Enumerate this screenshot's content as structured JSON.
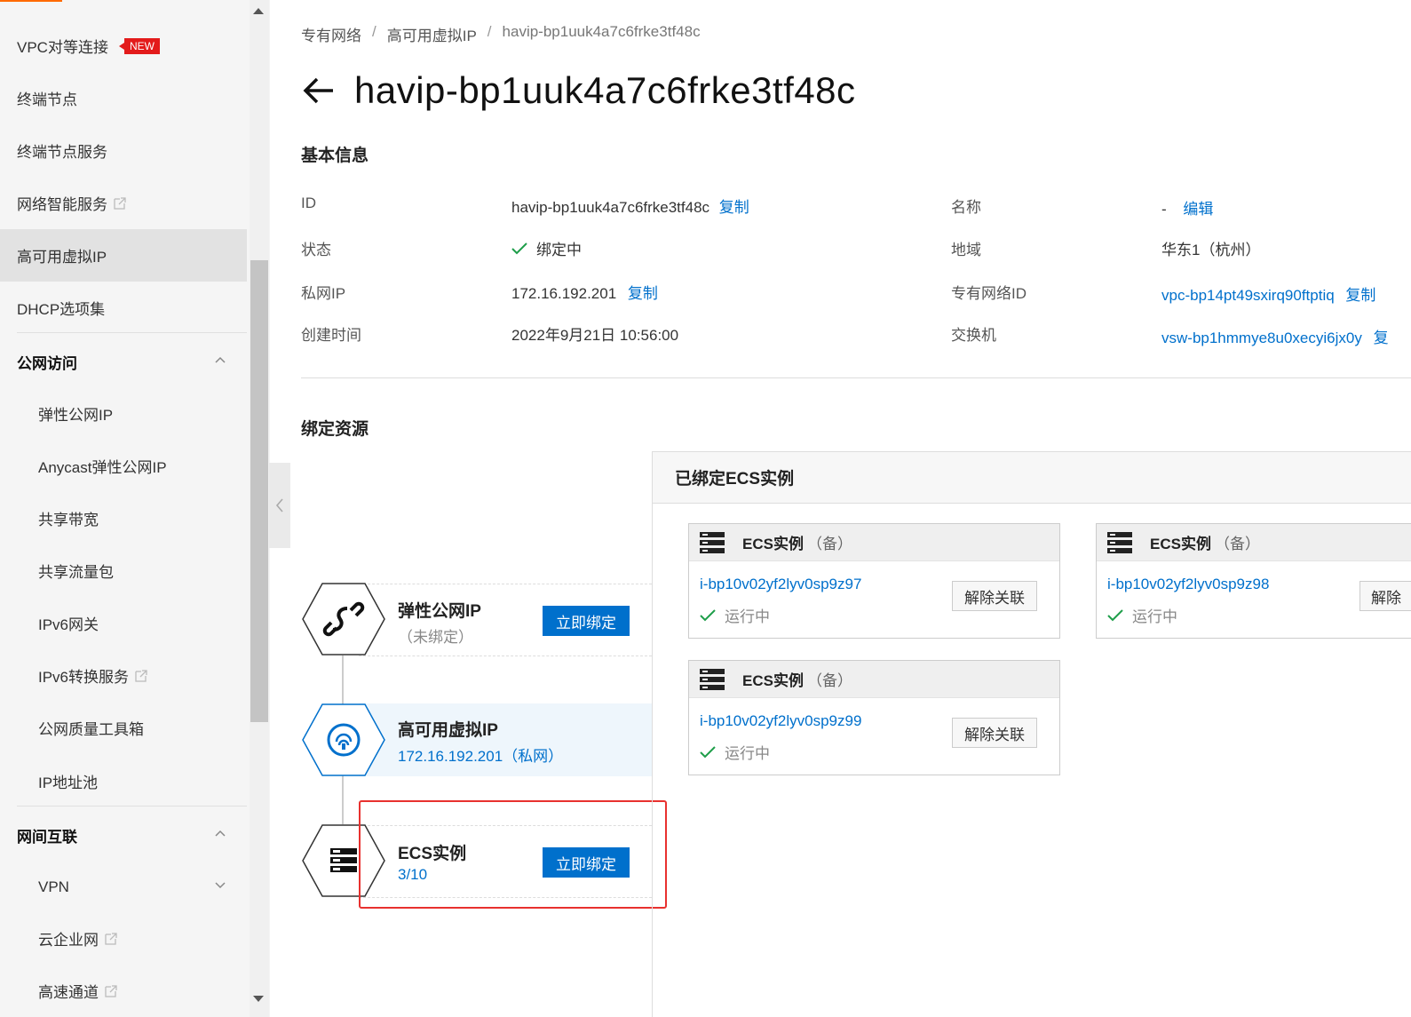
{
  "sidebar": {
    "items": [
      {
        "label": "VPC对等连接",
        "badge": "NEW"
      },
      {
        "label": "终端节点"
      },
      {
        "label": "终端节点服务"
      },
      {
        "label": "网络智能服务",
        "external": true
      },
      {
        "label": "高可用虚拟IP",
        "active": true
      },
      {
        "label": "DHCP选项集"
      }
    ],
    "groups": [
      {
        "label": "公网访问",
        "expanded": true,
        "items": [
          {
            "label": "弹性公网IP"
          },
          {
            "label": "Anycast弹性公网IP"
          },
          {
            "label": "共享带宽"
          },
          {
            "label": "共享流量包"
          },
          {
            "label": "IPv6网关"
          },
          {
            "label": "IPv6转换服务",
            "external": true
          },
          {
            "label": "公网质量工具箱"
          },
          {
            "label": "IP地址池"
          }
        ]
      },
      {
        "label": "网间互联",
        "expanded": true,
        "items": [
          {
            "label": "VPN",
            "expandable": true
          },
          {
            "label": "云企业网",
            "external": true
          },
          {
            "label": "高速通道",
            "external": true
          }
        ]
      }
    ]
  },
  "breadcrumb": [
    "专有网络",
    "高可用虚拟IP",
    "havip-bp1uuk4a7c6frke3tf48c"
  ],
  "page_title": "havip-bp1uuk4a7c6frke3tf48c",
  "basic_info": {
    "section_title": "基本信息",
    "copy_label": "复制",
    "edit_label": "编辑",
    "left": [
      {
        "label": "ID",
        "value": "havip-bp1uuk4a7c6frke3tf48c"
      },
      {
        "label": "状态",
        "value": "绑定中"
      },
      {
        "label": "私网IP",
        "value": "172.16.192.201"
      },
      {
        "label": "创建时间",
        "value": "2022年9月21日 10:56:00"
      }
    ],
    "right": [
      {
        "label": "名称",
        "value": "-"
      },
      {
        "label": "地域",
        "value": "华东1（杭州）"
      },
      {
        "label": "专有网络ID",
        "value": "vpc-bp14pt49sxirq90ftptiq"
      },
      {
        "label": "交换机",
        "value": "vsw-bp1hmmye8u0xecyi6jx0y",
        "copy_label": "复"
      }
    ]
  },
  "bound_resources": {
    "section_title": "绑定资源",
    "eip": {
      "name": "弹性公网IP",
      "sub": "（未绑定）",
      "button": "立即绑定"
    },
    "havip": {
      "name": "高可用虚拟IP",
      "sub": "172.16.192.201（私网）"
    },
    "ecs": {
      "name": "ECS实例",
      "count": "3/10",
      "button": "立即绑定"
    }
  },
  "ecs_panel": {
    "title": "已绑定ECS实例",
    "cards": [
      {
        "type": "ECS实例",
        "role": "（备）",
        "id": "i-bp10v02yf2lyv0sp9z97",
        "status": "运行中",
        "action": "解除关联"
      },
      {
        "type": "ECS实例",
        "role": "（备）",
        "id": "i-bp10v02yf2lyv0sp9z98",
        "status": "运行中",
        "action": "解除"
      },
      {
        "type": "ECS实例",
        "role": "（备）",
        "id": "i-bp10v02yf2lyv0sp9z99",
        "status": "运行中",
        "action": "解除关联"
      }
    ]
  },
  "colors": {
    "accent": "#0070cc",
    "success": "#1e9e4a",
    "badge": "#e31b1b",
    "highlight": "#e8312f"
  }
}
